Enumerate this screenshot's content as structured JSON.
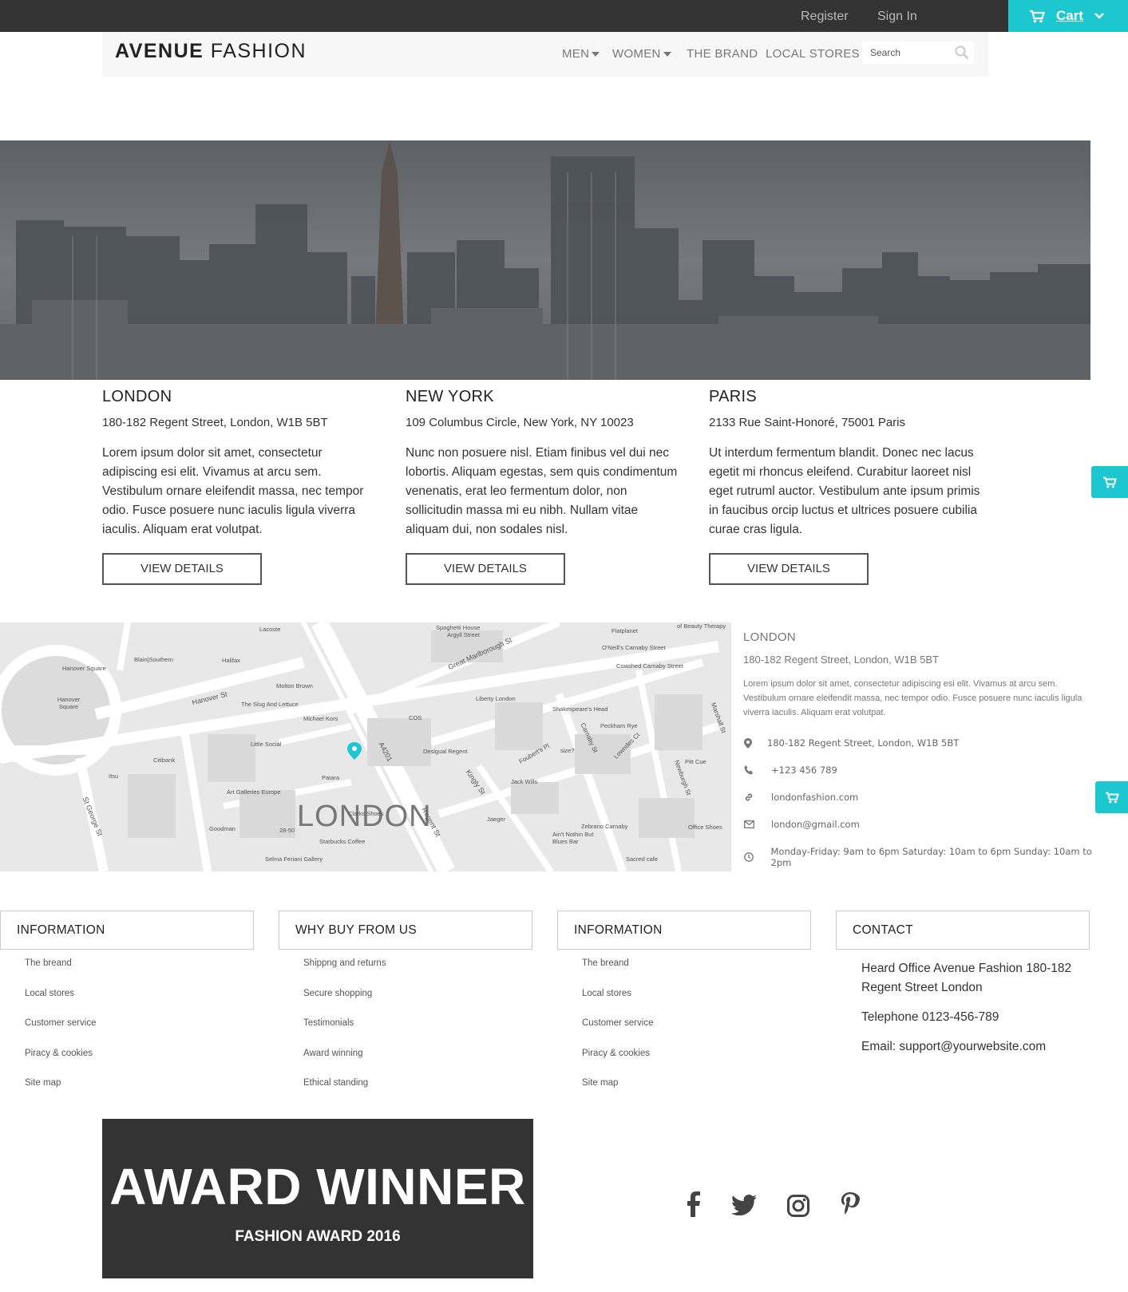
{
  "topbar": {
    "register": "Register",
    "sign_in": "Sign In",
    "cart": "Cart"
  },
  "brand": {
    "bold": "AVENUE",
    "light": "FASHION"
  },
  "nav": {
    "men": "MEN",
    "women": "WOMEN",
    "the_brand": "THE BRAND",
    "local_stores": "LOCAL STORES",
    "search_placeholder": "Search"
  },
  "stores": [
    {
      "city": "LONDON",
      "address": "180-182 Regent Street, London, W1B 5BT",
      "description": "Lorem ipsum dolor sit amet, consectetur adipiscing esi elit. Vivamus at arcu sem. Vestibulum ornare eleifendit massa, nec tempor odio. Fusce posuere nunc iaculis ligula viverra iaculis. Aliquam erat volutpat.",
      "button": "VIEW DETAILS"
    },
    {
      "city": "NEW YORK",
      "address": "109 Columbus Circle, New York, NY 10023",
      "description": "Nunc non posuere nisl. Etiam finibus vel dui nec lobortis. Aliquam egestas, sem quis condimentum venenatis, erat leo fermentum dolor, non sollicitudin massa mi eu nibh. Nullam vitae aliquam dui, non sodales nisl.",
      "button": "VIEW DETAILS"
    },
    {
      "city": "PARIS",
      "address": "2133 Rue Saint-Honoré, 75001 Paris",
      "description": "Ut interdum fermentum blandit. Donec nec lacus egetit mi rhoncus eleifend. Curabitur laoreet nisl eget rutruml auctor. Vestibulum ante ipsum primis in faucibus orcip luctus et ultrices posuere cubilia curae cras ligula.",
      "button": "VIEW DETAILS"
    }
  ],
  "map": {
    "city_label": "LONDON",
    "pois": [
      "Lacoste",
      "Spaghetti House",
      "Argyll Street",
      "Flatplanet",
      "of Beauty Therapy",
      "O'Neill's Carnaby Street",
      "Cowshed Carnaby Street",
      "Great Marlborough St",
      "Hanover Square",
      "Blain|Southern",
      "Halifax",
      "Hanover St",
      "Molton Brown",
      "Liberty London",
      "Shakespeare's Head",
      "Peckham Rye",
      "The Slug And Lettuce",
      "Michael Kors",
      "COS",
      "Little Social",
      "Citibank",
      "Desigual Regent",
      "size?",
      "Jack Wills",
      "Patara",
      "Art Galleries Europe",
      "Clarks Shoes",
      "Jaeger",
      "Zebrano Carnaby",
      "Ain't Nothin But Blues Bar",
      "Goodman",
      "Starbucks Coffee",
      "Selma Feriani Gallery",
      "Sacred cafe",
      "Office Shoes",
      "Pitt Cue",
      "A4201",
      "Regent St",
      "Kingly St",
      "Carnaby St",
      "Marshall St",
      "Newburgh St",
      "Lowndes Ct",
      "Foubert's Pl",
      "St George St",
      "Hanover Square",
      "Itsu",
      "28-50"
    ]
  },
  "map_info": {
    "title": "LONDON",
    "address": "180-182 Regent Street, London, W1B 5BT",
    "description": "Lorem ipsum dolor sit amet, consectetur adipiscing esi elit. Vivamus at arcu sem. Vestibulum ornare eleifendit massa, nec tempor odio. Fusce posuere nunc iaculis ligula viverra iaculis. Aliquam erat volutpat.",
    "lines": {
      "address": "180-182 Regent Street, London, W1B 5BT",
      "phone": "+123 456 789",
      "web": "londonfashion.com",
      "email": "london@gmail.com",
      "hours": "Monday-Friday: 9am to 6pm Saturday: 10am to 6pm Sunday: 10am to 2pm"
    }
  },
  "footer": {
    "col1": {
      "title": "INFORMATION",
      "links": [
        "The breand",
        "Local stores",
        "Customer service",
        "Piracy & cookies",
        "Site map"
      ]
    },
    "col2": {
      "title": "WHY BUY FROM US",
      "links": [
        "Shippng and returns",
        "Secure shopping",
        "Testimonials",
        "Award winning",
        "Ethical standing"
      ]
    },
    "col3": {
      "title": "INFORMATION",
      "links": [
        "The breand",
        "Local stores",
        "Customer service",
        "Piracy & cookies",
        "Site map"
      ]
    },
    "col4": {
      "title": "CONTACT",
      "office": "Heard Office Avenue Fashion 180-182 Regent Street London",
      "telephone": "Telephone 0123-456-789",
      "email": "Email: support@yourwebsite.com"
    }
  },
  "award": {
    "title": "AWARD WINNER",
    "subtitle": "FASHION AWARD 2016"
  },
  "colors": {
    "accent": "#1cc7cf",
    "dark": "#333333"
  }
}
